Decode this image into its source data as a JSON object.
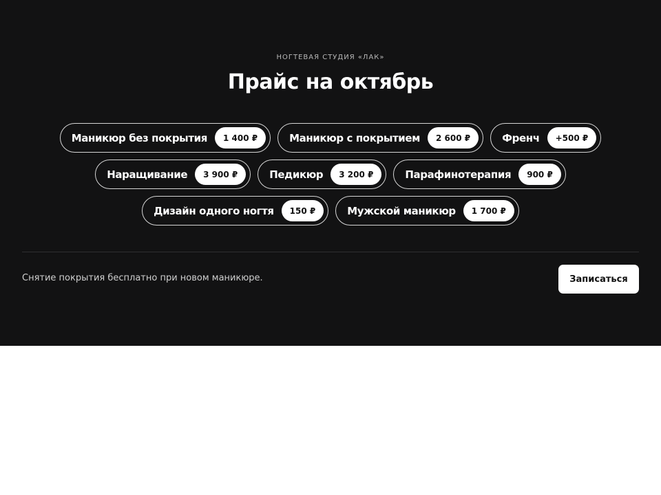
{
  "header": {
    "eyebrow": "НОГТЕВАЯ СТУДИЯ «ЛАК»",
    "title": "Прайс на октябрь"
  },
  "services": [
    {
      "label": "Маникюр без покрытия",
      "price": "1 400 ₽"
    },
    {
      "label": "Маникюр с покрытием",
      "price": "2 600 ₽"
    },
    {
      "label": "Френч",
      "price": "+500 ₽"
    },
    {
      "label": "Наращивание",
      "price": "3 900 ₽"
    },
    {
      "label": "Педикюр",
      "price": "3 200 ₽"
    },
    {
      "label": "Парафинотерапия",
      "price": "900 ₽"
    },
    {
      "label": "Дизайн одного ногтя",
      "price": "150 ₽"
    },
    {
      "label": "Мужской маникюр",
      "price": "1 700 ₽"
    }
  ],
  "footer": {
    "note": "Снятие покрытия бесплатно при новом маникюре.",
    "cta_label": "Записаться"
  },
  "colors": {
    "background": "#121213",
    "chip_border": "#d6d6d6",
    "price_pill": "#ffffff",
    "text": "#ffffff"
  }
}
